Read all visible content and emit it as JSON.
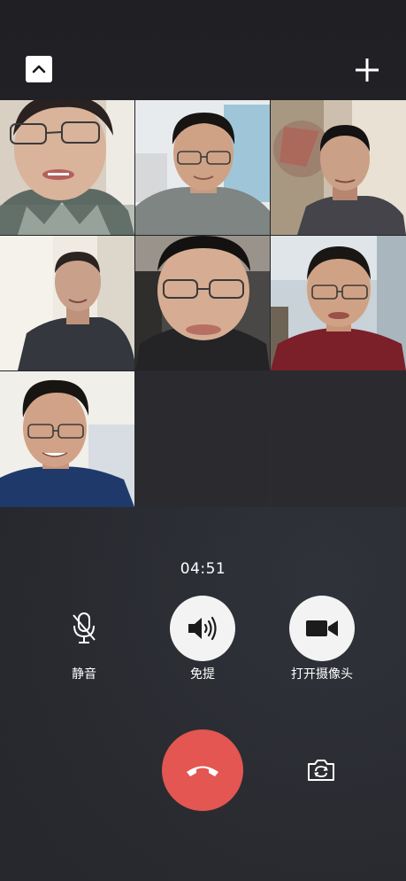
{
  "call": {
    "timer": "04:51",
    "participants": [
      {
        "id": "participant-1"
      },
      {
        "id": "participant-2"
      },
      {
        "id": "participant-3"
      },
      {
        "id": "participant-4"
      },
      {
        "id": "participant-5"
      },
      {
        "id": "participant-6"
      },
      {
        "id": "participant-7"
      }
    ]
  },
  "controls": {
    "mute_label": "静音",
    "speaker_label": "免提",
    "camera_label": "打开摄像头"
  },
  "icons": {
    "minimize": "chevron-up-icon",
    "add": "plus-icon",
    "mute": "microphone-off-icon",
    "speaker": "speaker-icon",
    "camera": "video-camera-icon",
    "hangup": "phone-hangup-icon",
    "switch_camera": "camera-switch-icon"
  },
  "colors": {
    "background": "#232327",
    "hangup": "#e35651",
    "control_fill": "#f3f3f3"
  }
}
